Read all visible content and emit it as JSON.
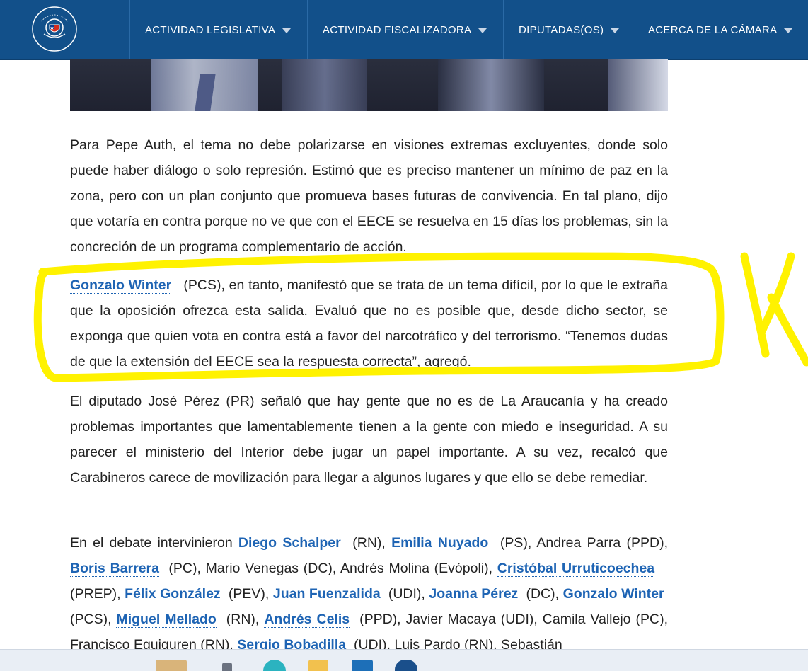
{
  "header": {
    "logo_text_top": "CÁMARA DE DIPUTADAS Y DIPUTADOS",
    "logo_text_bottom": "CHILE",
    "nav": [
      {
        "label": "ACTIVIDAD LEGISLATIVA"
      },
      {
        "label": "ACTIVIDAD FISCALIZADORA"
      },
      {
        "label": "DIPUTADAS(OS)"
      },
      {
        "label": "ACERCA DE LA CÁMARA"
      }
    ]
  },
  "article": {
    "p1": "Para Pepe Auth, el tema no debe polarizarse en visiones extremas excluyentes, donde solo puede haber diálogo o solo represión. Estimó que es preciso mantener un mínimo de paz en la zona, pero con un plan conjunto que promueva bases futuras de convivencia. En tal plano, dijo que votaría en contra porque no ve que con el EECE se resuelva en 15 días los problemas, sin la concreción de un programa complementario de acción.",
    "p2_link": "Gonzalo Winter",
    "p2_text": " (PCS), en tanto, manifestó que se trata de un tema difícil, por lo que le extraña que la oposición ofrezca esta salida. Evaluó que no es posible que, desde dicho sector, se exponga que quien vota en contra está a favor del narcotráfico y del terrorismo. “Tenemos dudas de que la extensión del EECE sea la respuesta correcta”, agregó.",
    "p3": "El  diputado José Pérez (PR) señaló que hay gente que no es de La Araucanía y ha creado problemas importantes que lamentablemente tienen a la gente con miedo e inseguridad. A su parecer el ministerio del Interior debe jugar un papel importante. A su vez, recalcó que Carabineros carece de movilización para llegar a algunos lugares y que ello se debe remediar.",
    "p4": {
      "intro": "En el debate intervinieron ",
      "l1": "Diego Schalper",
      "t1": " (RN), ",
      "l2": "Emilia Nuyado",
      "t2": " (PS), Andrea Parra (PPD), ",
      "l3": "Boris Barrera",
      "t3": " (PC), Mario Venegas (DC), Andrés Molina (Evópoli), ",
      "l4": "Cristóbal Urruticoechea",
      "t4": " (PREP), ",
      "l5": "Félix González",
      "t5": " (PEV), ",
      "l6": "Juan Fuenzalida",
      "t6": " (UDI), ",
      "l7": "Joanna Pérez",
      "t7": " (DC), ",
      "l8": "Gonzalo Winter",
      "t8": " (PCS), ",
      "l9": "Miguel Mellado",
      "t9": " (RN), ",
      "l10": "Andrés Celis",
      "t10": " (PPD), Javier Macaya (UDI), Camila Vallejo (PC), Francisco Eguiguren (RN), ",
      "l11": "Sergio Bobadilla",
      "t11": " (UDI), Luis Pardo (RN), Sebastián"
    }
  },
  "colors": {
    "nav_bg": "#12508a",
    "link": "#1e64b4",
    "highlight": "#fff200"
  }
}
